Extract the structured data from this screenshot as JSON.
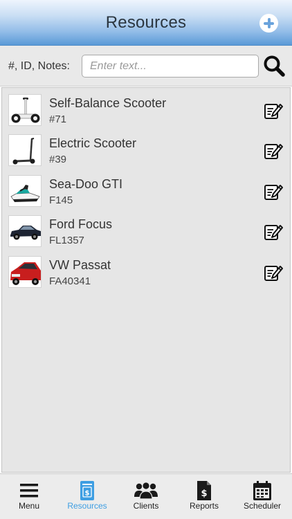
{
  "header": {
    "title": "Resources",
    "add_icon": "plus-circle-icon"
  },
  "search": {
    "label": "#, ID, Notes:",
    "placeholder": "Enter text...",
    "value": "",
    "icon": "search-icon"
  },
  "resources": [
    {
      "name": "Self-Balance Scooter",
      "id": "#71",
      "thumbnail": "self-balance-scooter-photo"
    },
    {
      "name": "Electric Scooter",
      "id": "#39",
      "thumbnail": "electric-scooter-photo"
    },
    {
      "name": "Sea-Doo GTI",
      "id": "F145",
      "thumbnail": "jet-ski-photo"
    },
    {
      "name": "Ford Focus",
      "id": "FL1357",
      "thumbnail": "dark-sedan-photo"
    },
    {
      "name": "VW Passat",
      "id": "FA40341",
      "thumbnail": "red-hatchback-photo"
    }
  ],
  "tabs": [
    {
      "label": "Menu",
      "icon": "hamburger-menu-icon",
      "active": false
    },
    {
      "label": "Resources",
      "icon": "resources-document-icon",
      "active": true
    },
    {
      "label": "Clients",
      "icon": "people-group-icon",
      "active": false
    },
    {
      "label": "Reports",
      "icon": "report-dollar-icon",
      "active": false
    },
    {
      "label": "Scheduler",
      "icon": "calendar-icon",
      "active": false
    }
  ],
  "colors": {
    "accent": "#3e9ee2",
    "header_bottom": "#5a9ad7",
    "list_bg": "#e6e6e6"
  }
}
